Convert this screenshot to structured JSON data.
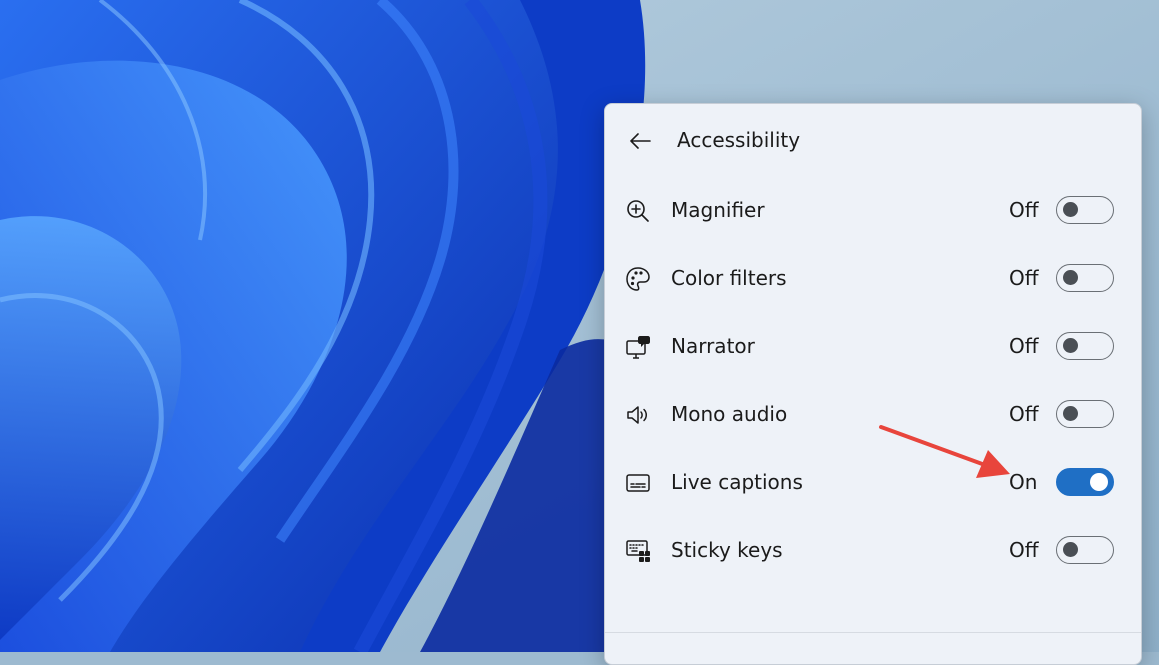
{
  "panel": {
    "title": "Accessibility",
    "back_icon": "arrow-left-icon",
    "items": [
      {
        "label": "Magnifier",
        "state": "Off",
        "on": false,
        "icon": "magnifier-icon"
      },
      {
        "label": "Color filters",
        "state": "Off",
        "on": false,
        "icon": "palette-icon"
      },
      {
        "label": "Narrator",
        "state": "Off",
        "on": false,
        "icon": "narrator-icon"
      },
      {
        "label": "Mono audio",
        "state": "Off",
        "on": false,
        "icon": "speaker-icon"
      },
      {
        "label": "Live captions",
        "state": "On",
        "on": true,
        "icon": "captions-icon"
      },
      {
        "label": "Sticky keys",
        "state": "Off",
        "on": false,
        "icon": "keyboard-icon"
      }
    ]
  },
  "colors": {
    "accent": "#1f6fc5",
    "annotation_arrow": "#e8453c"
  }
}
